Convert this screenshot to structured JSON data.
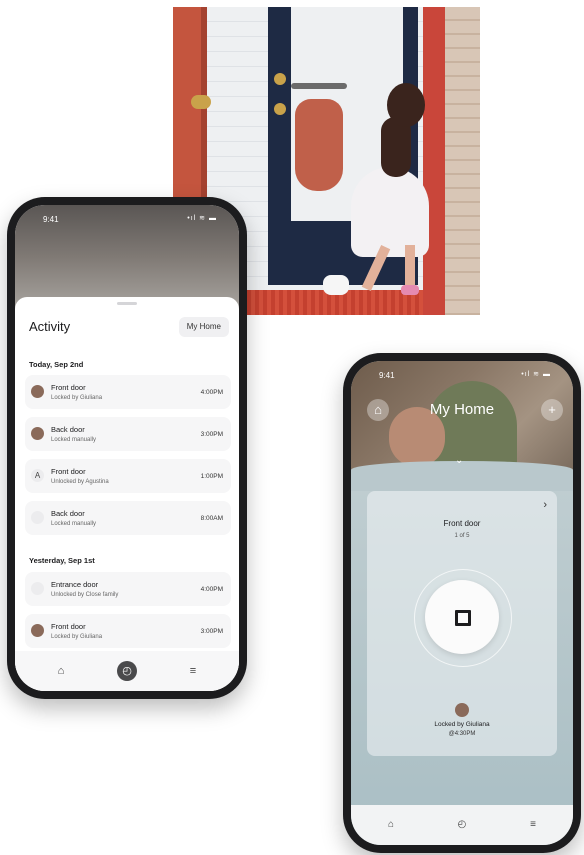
{
  "phone_activity": {
    "status": {
      "time": "9:41",
      "icons": "•ıl ≋ ▬"
    },
    "title": "Activity",
    "home_chip": "My Home",
    "sections": [
      {
        "date": "Today, Sep 2nd"
      },
      {
        "date": "Yesterday, Sep 1st"
      }
    ],
    "items": [
      {
        "name": "Front door",
        "sub": "Locked by Giuliana",
        "time": "4:00PM"
      },
      {
        "name": "Back door",
        "sub": "Locked manually",
        "time": "3:00PM"
      },
      {
        "name": "Front door",
        "sub": "Unlocked by Agustina",
        "time": "1:00PM",
        "letter": "A"
      },
      {
        "name": "Back door",
        "sub": "Locked manually",
        "time": "8:00AM"
      },
      {
        "name": "Entrance door",
        "sub": "Unlocked by Close family",
        "time": "4:00PM"
      },
      {
        "name": "Front door",
        "sub": "Locked by Giuliana",
        "time": "3:00PM"
      }
    ],
    "tabs": {
      "home": "⌂",
      "history": "◴",
      "settings": "≡"
    }
  },
  "phone_home": {
    "status": {
      "time": "9:41",
      "icons": "•ıl ≋ ▬"
    },
    "title": "My Home",
    "left_icon": "⌂",
    "right_icon": "+",
    "chevron": "⌄",
    "card": {
      "arrow": "›",
      "door_name": "Front door",
      "count": "1 of 5",
      "locked_by": "Locked by Giuliana",
      "locked_time": "@4:30PM"
    },
    "tabs": {
      "home": "⌂",
      "history": "◴",
      "settings": "≡"
    }
  },
  "icons": [
    "home-icon",
    "history-icon",
    "settings-icon",
    "lock-icon",
    "plus-icon",
    "chevron-down-icon",
    "chevron-right-icon"
  ]
}
